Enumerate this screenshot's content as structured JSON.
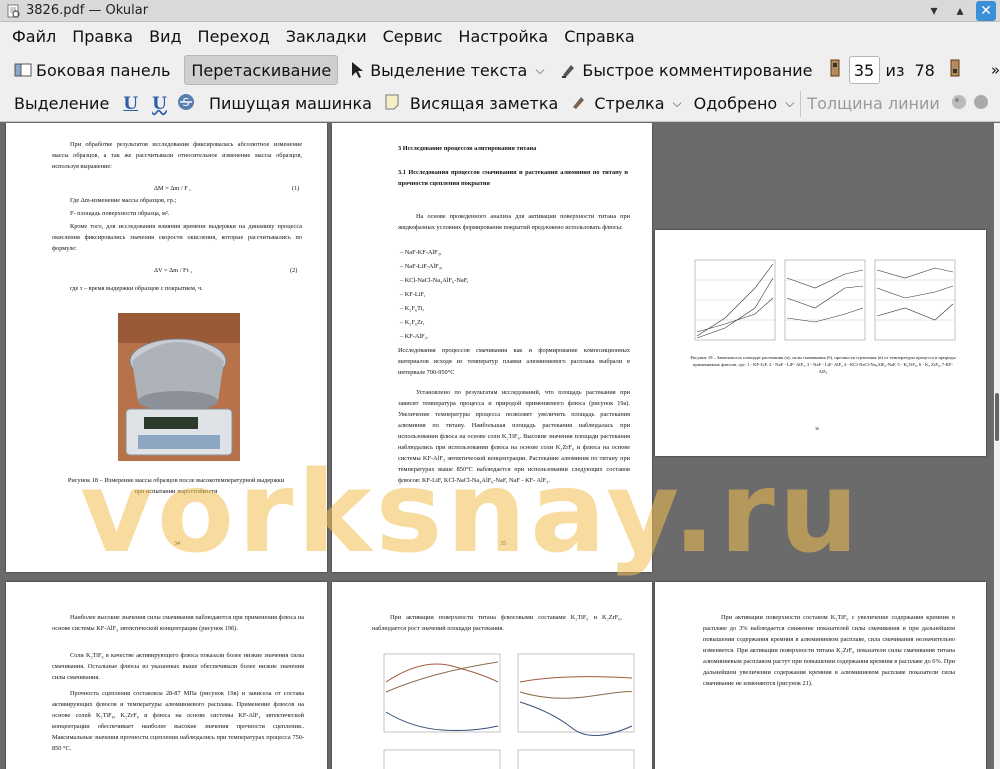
{
  "window": {
    "title": "3826.pdf  — Okular"
  },
  "menu": [
    "Файл",
    "Правка",
    "Вид",
    "Переход",
    "Закладки",
    "Сервис",
    "Настройка",
    "Справка"
  ],
  "toolbar1": {
    "sidebar": "Боковая панель",
    "drag": "Перетаскивание",
    "select_text": "Выделение текста",
    "quick_comment": "Быстрое комментирование",
    "page_current": "35",
    "page_of": "из",
    "page_total": "78"
  },
  "toolbar2": {
    "selection": "Выделение",
    "typewriter": "Пишущая машинка",
    "note": "Висящая заметка",
    "arrow": "Стрелка",
    "approved": "Одобрено",
    "line_width": "Толщина линии"
  },
  "watermark": "vorksnay.ru",
  "page34": {
    "p1": "При обработке результатов исследования фиксировалась абсолютное изменение массы образцов, а так же рассчитывали относительное изменение массы образцов, используя выражение:",
    "f1": "ΔM = Δm / F ,",
    "f1n": "(1)",
    "p2": "Где Δm-изменение массы образцов, гр.;",
    "p3": "F- площадь поверхности образца, м².",
    "p4": "Кроме того, для исследования влияния времени выдержки на динамику процесса окисления фиксировались значения скорости окисления, которые рассчитывались по формуле:",
    "f2": "ΔV = Δm / Fτ ,",
    "f2n": "(2)",
    "p5": "где τ – время выдержки образцов с покрытием, ч.",
    "caption": "Рисунок 18 – Измерение массы образцов после высокотемпературной выдержки при испытании жаростойкости",
    "num": "34"
  },
  "page35": {
    "h1": "3 Исследование процессов алитирования титана",
    "h2": "3.1  Исследования процессов смачивания и растекания алюминия по титану и прочности сцепления покрытия",
    "p1": "На основе проведенного анализа для активации поверхности титана при жидкофазных условиях формирования покрытий предложено использовать флюсы:",
    "list": [
      "NaF-KF-AlF₃,",
      "NaF-LiF-AlF₃,",
      "KCl-NaCl-Na₃AlF₆-NaF,",
      "KF-LiF,",
      "K₂F₆Ti,",
      "K₂F₆Zr,",
      "KF-AlF₃."
    ],
    "p2": "Исследования процессов смачивания как и формирование композиционных материалов исходя из температур плавки алюминиевого расплава выбрали в интервале 700-950°С",
    "p3": "Установлено по результатам исследований, что площадь растекания при зависит температура процесса и природой применяемого флюса (рисунок 19а). Увеличение температуры процесса позволяет увеличить площадь растекания алюминия по титану. Наибольшая площадь растекания наблюдалась при использовании флюса на основе соли K₂TiF₆. Высокие значения площади растекания наблюдались при использовании флюса на основе соли K₂ZrF₆ и флюса на основе системы   KF-AlF₃ эвтектической концентрации. Растекание алюминия по титану при температурах выше 850°С наблюдается при использовании следующих составов флюсов: KF-LiF, KCl-NaCl-Na₃AlF₆-NaF, NaF - KF- AlF₃.",
    "num": "35"
  },
  "page36": {
    "caption": "Рисунок 19 – Зависимость площади растекания (а), силы смачивания (б), прочности сцепления (в) от температуры процесса и природы применяемых флюсов, где: 1 - KF-LiF, 2 - NaF - LiF- AlF₃, 3 - NaF - LiF- AlF₃ 4 - KCl-NaCl-Na₃AlF₆-NaF, 5 - K₂TiF₆, 6 - K₂ ZrF₆, 7-KF-AlF₃",
    "num": "36"
  },
  "page37": {
    "p1": "Наиболее высокие значения силы смачивания наблюдаются при применения флюса на основе системы KF-AlF₃ эвтектической концентрации (рисунок 19б).",
    "p2": "Соли K₂TiF₆ в качестве активирующего флюса показали более низкие значения силы смачивания.   Остальные флюсы из указанных выше обеспечивали более низкие значения силы смачивания.",
    "p3": "Прочность сцепления  составляла 28-87 МПа (рисунок 19в) и зависела от состава активирующих флюсов и температуры алюминиевого расплава. Применение флюсов на основе солей K₂TiF₆, K₂ZrF₆ и флюса на основе системы   KF-AlF₃ эвтектической концентрации обеспечивает наиболее высокие значения прочности сцепления.. Максимальные значения прочности сцепления наблюдались при температурах процесса 750-850 °С."
  },
  "page38": {
    "p1": "При активации поверхности титана флюсовыми составами K₂TiF₆ и K₂ZrF₆, наблюдается рост значений площади растекания."
  },
  "page39": {
    "p1": "При активации поверхности составом K₂TiF₆ с увеличение содержания кремния в расплаве до 3% наблюдается снижение показателей силы смачивания и при дальнейшем повышении содержания кремния в алюминиевом расплаве, сила смачивания незначительно изменяется. При активации поверхности титана K₂ZrF₆ показатели силы смачивания титана алюминиевым расплавом растут при повышении содержания кремния в расплаве до 6%. При дальнейшем увеличении содержания кремния в алюминиевом расплаве показатели силы смачивание не изменяются (рисунок 21)."
  },
  "colors": {
    "accent": "#3b8fd6",
    "watermark": "#f0be50",
    "viewport_bg": "#6b6b6b"
  }
}
